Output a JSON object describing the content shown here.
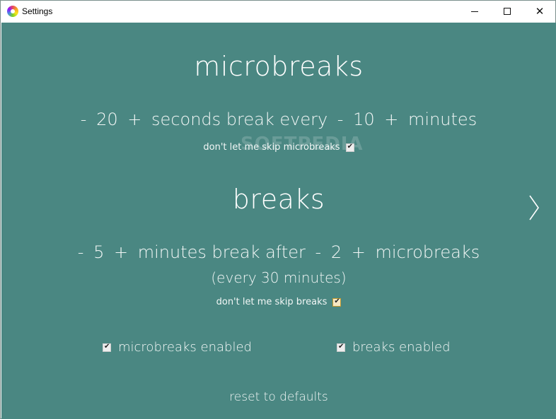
{
  "window": {
    "title": "Settings"
  },
  "microbreaks": {
    "heading": "microbreaks",
    "duration_value": "20",
    "duration_unit": "seconds break every",
    "interval_value": "10",
    "interval_unit": "minutes",
    "strict_label": "don't let me skip microbreaks",
    "strict_checked": true
  },
  "breaks": {
    "heading": "breaks",
    "duration_value": "5",
    "duration_unit": "minutes break after",
    "interval_value": "2",
    "interval_unit": "microbreaks",
    "every_text": "(every 30 minutes)",
    "strict_label": "don't let me skip breaks",
    "strict_checked": true
  },
  "toggles": {
    "microbreaks_label": "microbreaks enabled",
    "microbreaks_checked": true,
    "breaks_label": "breaks enabled",
    "breaks_checked": true
  },
  "footer": {
    "reset_label": "reset to defaults"
  },
  "controls": {
    "minus": "-",
    "plus": "+"
  },
  "watermark": "SOFTPEDIA",
  "icons": {
    "app": "app-logo-icon",
    "next": "chevron-right-icon"
  },
  "colors": {
    "background": "#4a8782",
    "text": "#ffffff"
  }
}
